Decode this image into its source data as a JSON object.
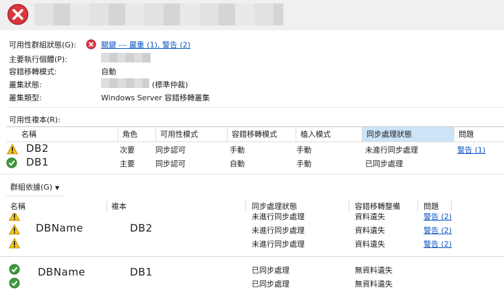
{
  "summary": {
    "health_label": "可用性群組狀態(G):",
    "health_value": "關鍵 --- 嚴重 (1), 警告 (2)",
    "primary_label": "主要執行個體(P):",
    "failover_mode_label": "容錯移轉模式:",
    "failover_mode_value": "自動",
    "cluster_state_label": "叢集狀態:",
    "cluster_state_value": "(標準仲裁)",
    "cluster_type_label": "叢集類型:",
    "cluster_type_value": "Windows Server 容錯移轉叢集"
  },
  "replicas": {
    "section_label": "可用性複本(R):",
    "columns": [
      "名稱",
      "角色",
      "可用性模式",
      "容錯移轉模式",
      "植入模式",
      "同步處理狀態",
      "問題"
    ],
    "rows": [
      {
        "status_icon": "warning-icon",
        "name": "DB2",
        "role": "次要",
        "availability": "同步認可",
        "failover": "手動",
        "seeding": "手動",
        "sync": "未進行同步處理",
        "issues": "警告 (1)"
      },
      {
        "status_icon": "check-icon",
        "name": "DB1",
        "role": "主要",
        "availability": "同步認可",
        "failover": "自動",
        "seeding": "手動",
        "sync": "已同步處理",
        "issues": ""
      }
    ]
  },
  "databases": {
    "group_by_label": "群組依據(G)",
    "columns": [
      "名稱",
      "複本",
      "同步處理狀態",
      "容錯移轉整備",
      "問題"
    ],
    "groups": [
      {
        "name": "DBName",
        "replica": "DB2",
        "rows": [
          {
            "status_icon": "warning-icon",
            "sync": "未進行同步處理",
            "readiness": "資料遺失",
            "issues": "警告 (2)"
          },
          {
            "status_icon": "warning-icon",
            "sync": "未進行同步處理",
            "readiness": "資料遺失",
            "issues": "警告 (2)"
          },
          {
            "status_icon": "warning-icon",
            "sync": "未進行同步處理",
            "readiness": "資料遺失",
            "issues": "警告 (2)"
          }
        ]
      },
      {
        "name": "DBName",
        "replica": "DB1",
        "rows": [
          {
            "status_icon": "check-icon",
            "sync": "已同步處理",
            "readiness": "無資料遺失",
            "issues": ""
          },
          {
            "status_icon": "check-icon",
            "sync": "已同步處理",
            "readiness": "無資料遺失",
            "issues": ""
          }
        ]
      }
    ]
  },
  "colors": {
    "error_red": "#d9383e",
    "warning_yellow": "#f4c20d",
    "ok_green": "#3c9a3c",
    "link_blue": "#0b55c4",
    "selected_header": "#cce4f7"
  }
}
